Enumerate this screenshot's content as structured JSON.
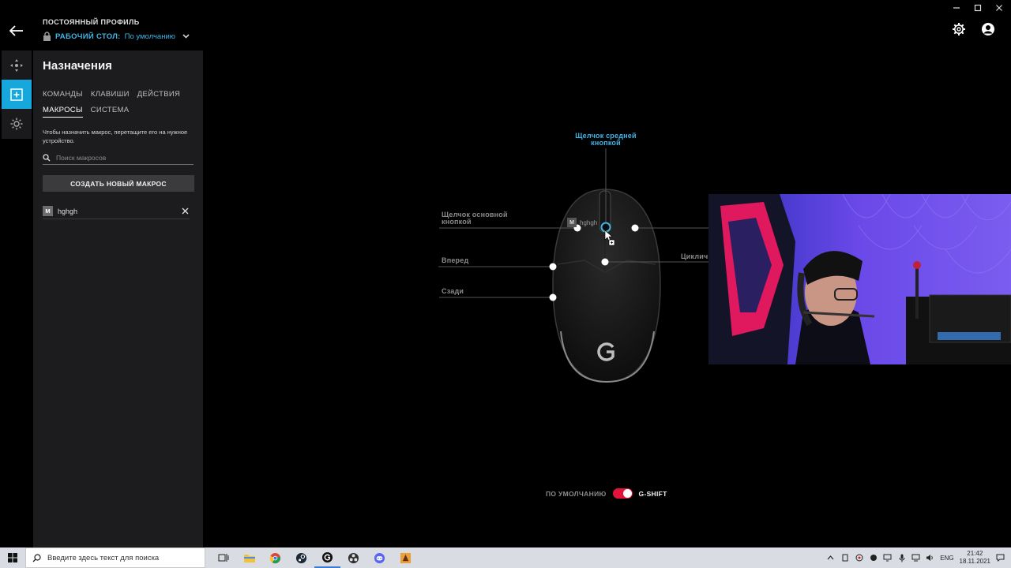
{
  "header": {
    "profile_caption": "ПОСТОЯННЫЙ ПРОФИЛЬ",
    "profile_kind": "РАБОЧИЙ СТОЛ:",
    "profile_value": "По умолчанию"
  },
  "panel": {
    "title": "Назначения",
    "tabs_row1": [
      "КОМАНДЫ",
      "КЛАВИШИ",
      "ДЕЙСТВИЯ"
    ],
    "tabs_row2": [
      "МАКРОСЫ",
      "СИСТЕМА"
    ],
    "active_tab": "МАКРОСЫ",
    "hint": "Чтобы назначить макрос, перетащите его на нужное устройство.",
    "search_placeholder": "Поиск макросов",
    "create_button": "СОЗДАТЬ НОВЫЙ МАКРОС",
    "macros": [
      {
        "badge": "M",
        "name": "hghgh"
      }
    ]
  },
  "diagram": {
    "middle_click": "Щелчок средней кнопкой",
    "primary_click": "Щелчок основной кнопкой",
    "forward": "Вперед",
    "back": "Сзади",
    "cycle_cut": "Циклич",
    "assigned_badge": "M",
    "assigned_name": "hghgh"
  },
  "mode_toggle": {
    "off_label": "ПО УМОЛЧАНИЮ",
    "on_label": "G-SHIFT",
    "state": "on"
  },
  "taskbar": {
    "search_placeholder": "Введите здесь текст для поиска",
    "language": "ENG",
    "time": "21:42",
    "date": "18.11.2021",
    "apps": [
      "task-view",
      "file-explorer",
      "chrome",
      "steam",
      "logitech-g-hub",
      "obs",
      "discord",
      "game"
    ]
  },
  "colors": {
    "accent": "#16a7dd",
    "toggle_on": "#e2143c",
    "panel_bg": "#1c1c1e"
  }
}
